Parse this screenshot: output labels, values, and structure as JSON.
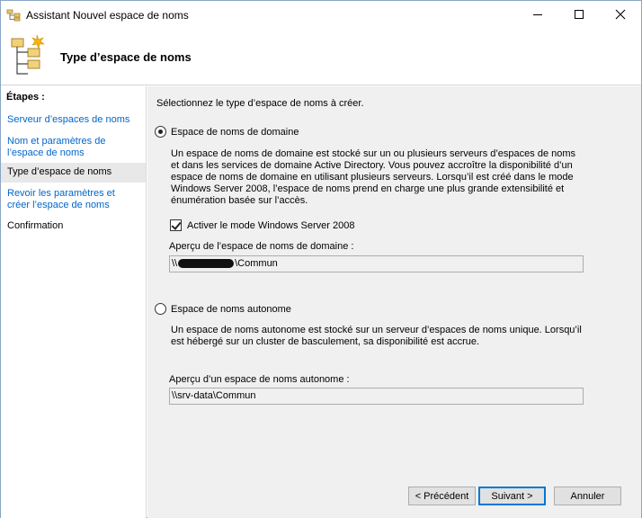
{
  "window": {
    "title": "Assistant Nouvel espace de noms",
    "page_title": "Type d’espace de noms"
  },
  "nav": {
    "heading": "Étapes :",
    "items": [
      {
        "label": "Serveur d’espaces de noms",
        "state": "link"
      },
      {
        "label": "Nom et paramètres de l’espace de noms",
        "state": "link"
      },
      {
        "label": "Type d’espace de noms",
        "state": "current"
      },
      {
        "label": "Revoir les paramètres et créer l’espace de noms",
        "state": "link"
      },
      {
        "label": "Confirmation",
        "state": "disabled"
      }
    ]
  },
  "main": {
    "prompt": "Sélectionnez le type d’espace de noms à créer.",
    "domain": {
      "label": "Espace de noms de domaine",
      "selected": true,
      "description": "Un espace de noms de domaine est stocké sur un ou plusieurs serveurs d’espaces de noms et dans les services de domaine Active Directory. Vous pouvez accroître la disponibilité d’un espace de noms de domaine en utilisant plusieurs serveurs. Lorsqu’il est créé dans le mode Windows Server 2008, l’espace de noms prend en charge une plus grande extensibilité et énumération basée sur l’accès.",
      "checkbox_label": "Activer le mode Windows Server 2008",
      "checkbox_checked": true,
      "preview_label": "Aperçu de l’espace de noms de domaine :",
      "preview_prefix": "\\\\",
      "preview_suffix": "\\Commun"
    },
    "standalone": {
      "label": "Espace de noms autonome",
      "selected": false,
      "description": "Un espace de noms autonome est stocké sur un serveur d’espaces de noms unique. Lorsqu’il est hébergé sur un cluster de basculement, sa disponibilité est accrue.",
      "preview_label": "Aperçu d’un espace de noms autonome :",
      "preview_value": "\\\\srv-data\\Commun"
    }
  },
  "buttons": {
    "prev": "< Précédent",
    "next": "Suivant >",
    "cancel": "Annuler"
  },
  "colors": {
    "link": "#0066cc",
    "accent": "#0078d7",
    "panel": "#f0f0f0"
  }
}
